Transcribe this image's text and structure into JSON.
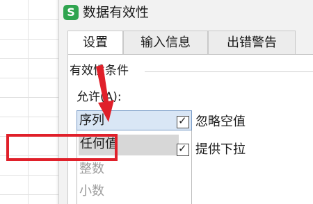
{
  "dialog": {
    "app_icon_glyph": "S",
    "title": "数据有效性",
    "tabs": [
      {
        "label": "设置"
      },
      {
        "label": "输入信息"
      },
      {
        "label": "出错警告"
      }
    ],
    "group_label": "有效性条件",
    "allow_label": "允许(A):",
    "allow_select": {
      "value": "序列",
      "options": [
        {
          "label": "任何值"
        },
        {
          "label": "整数"
        },
        {
          "label": "小数"
        }
      ]
    },
    "checkboxes": [
      {
        "label": "忽略空值",
        "checked": true
      },
      {
        "label": "提供下拉",
        "checked": true
      }
    ]
  },
  "annotation_colors": {
    "arrow": "#e0202a",
    "highlight_box": "#e0202a"
  },
  "accent_colors": {
    "app_icon": "#2fa44f",
    "select_bg": "#d9e6f5"
  }
}
